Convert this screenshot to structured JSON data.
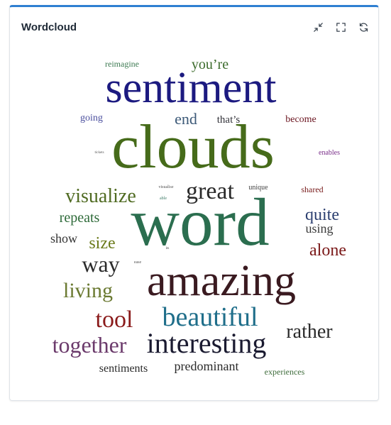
{
  "widget": {
    "title": "Wordcloud",
    "accent_color": "#2f7fd1",
    "actions": [
      {
        "icon": "collapse-icon"
      },
      {
        "icon": "fullscreen-icon"
      },
      {
        "icon": "refresh-icon"
      }
    ]
  },
  "words": [
    {
      "text": "reimagine",
      "color": "#3d7a52"
    },
    {
      "text": "you’re",
      "color": "#3c6b2c"
    },
    {
      "text": "sentiment",
      "color": "#1c1a80"
    },
    {
      "text": "going",
      "color": "#4b4f9e"
    },
    {
      "text": "end",
      "color": "#3d5a78"
    },
    {
      "text": "that’s",
      "color": "#33333a"
    },
    {
      "text": "become",
      "color": "#6b1520"
    },
    {
      "text": "clouds",
      "color": "#466b1a"
    },
    {
      "text": "enables",
      "color": "#7a2f8a"
    },
    {
      "text": "tickets",
      "color": "#555555"
    },
    {
      "text": "visualize",
      "color": "#506b22"
    },
    {
      "text": "visualise",
      "color": "#555555"
    },
    {
      "text": "able",
      "color": "#3d7a66"
    },
    {
      "text": "great",
      "color": "#2a2a2a"
    },
    {
      "text": "unique",
      "color": "#444444"
    },
    {
      "text": "shared",
      "color": "#7a2020"
    },
    {
      "text": "repeats",
      "color": "#2f6b3a"
    },
    {
      "text": "word",
      "color": "#2b6e4f"
    },
    {
      "text": "quite",
      "color": "#2c3f70"
    },
    {
      "text": "show",
      "color": "#333333"
    },
    {
      "text": "size",
      "color": "#6b7a1a"
    },
    {
      "text": "using",
      "color": "#3a3a3a"
    },
    {
      "text": "its",
      "color": "#444444"
    },
    {
      "text": "alone",
      "color": "#7a1818"
    },
    {
      "text": "way",
      "color": "#2a2a2a"
    },
    {
      "text": "ease",
      "color": "#555555"
    },
    {
      "text": "living",
      "color": "#6b7a32"
    },
    {
      "text": "amazing",
      "color": "#3a1a20"
    },
    {
      "text": "tool",
      "color": "#8a1a1a"
    },
    {
      "text": "beautiful",
      "color": "#1f6e8a"
    },
    {
      "text": "rather",
      "color": "#2a2a2a"
    },
    {
      "text": "together",
      "color": "#6b3a6b"
    },
    {
      "text": "interesting",
      "color": "#1a1a30"
    },
    {
      "text": "sentiments",
      "color": "#2a2a2a"
    },
    {
      "text": "predominant",
      "color": "#2a2a2a"
    },
    {
      "text": "experiences",
      "color": "#3d6b3a"
    }
  ]
}
